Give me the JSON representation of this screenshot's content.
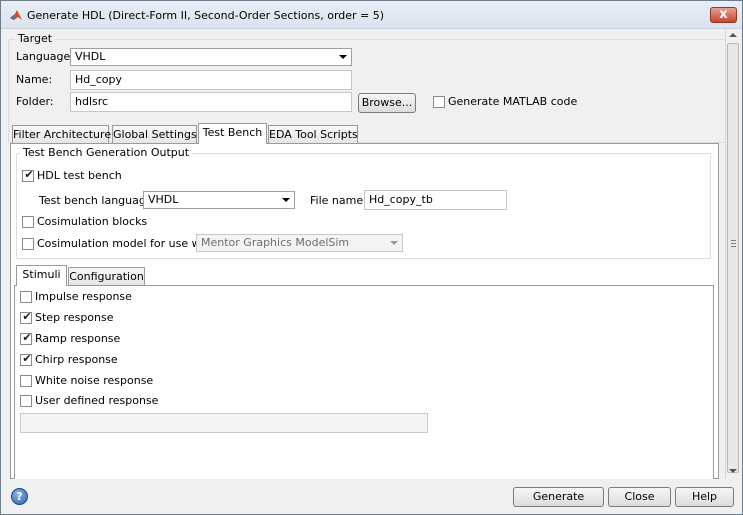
{
  "window": {
    "title": "Generate HDL (Direct-Form II, Second-Order Sections, order = 5)",
    "close_glyph": "x"
  },
  "target": {
    "group_title": "Target",
    "language_label": "Language:",
    "language_value": "VHDL",
    "name_label": "Name:",
    "name_value": "Hd_copy",
    "folder_label": "Folder:",
    "folder_value": "hdlsrc",
    "browse_label": "Browse...",
    "generate_matlab_label": "Generate MATLAB code",
    "generate_matlab_checked": false
  },
  "tabs": [
    {
      "label": "Filter Architecture",
      "active": false
    },
    {
      "label": "Global Settings",
      "active": false
    },
    {
      "label": "Test Bench",
      "active": true
    },
    {
      "label": "EDA Tool Scripts",
      "active": false
    }
  ],
  "test_bench": {
    "group_title": "Test Bench Generation Output",
    "hdl_test_bench_label": "HDL test bench",
    "hdl_test_bench_checked": true,
    "language_label": "Test bench language:",
    "language_value": "VHDL",
    "file_name_label": "File name:",
    "file_name_value": "Hd_copy_tb",
    "cosim_blocks_label": "Cosimulation blocks",
    "cosim_blocks_checked": false,
    "cosim_model_label": "Cosimulation model for use with:",
    "cosim_model_checked": false,
    "cosim_model_value": "Mentor Graphics ModelSim"
  },
  "sub_tabs": [
    {
      "label": "Stimuli",
      "active": true
    },
    {
      "label": "Configuration",
      "active": false
    }
  ],
  "stimuli": {
    "items": [
      {
        "label": "Impulse response",
        "checked": false
      },
      {
        "label": "Step response",
        "checked": true
      },
      {
        "label": "Ramp response",
        "checked": true
      },
      {
        "label": "Chirp response",
        "checked": true
      },
      {
        "label": "White noise response",
        "checked": false
      },
      {
        "label": "User defined response",
        "checked": false
      }
    ],
    "user_defined_value": ""
  },
  "footer": {
    "help_glyph": "?",
    "generate_label": "Generate",
    "close_label": "Close",
    "help_label": "Help"
  },
  "colors": {
    "accent": "#c8452c",
    "window_bg": "#f0f0f0",
    "panel_bg": "#ffffff"
  },
  "icons": {
    "title": "matlab-logo-icon",
    "close": "close-icon",
    "help": "help-icon",
    "combo": "chevron-down-icon",
    "check": "checkmark-icon"
  }
}
